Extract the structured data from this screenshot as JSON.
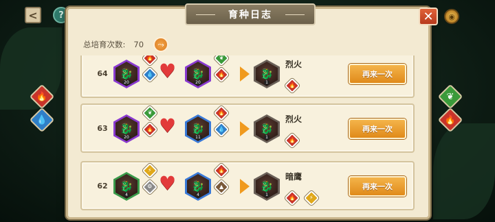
{
  "panel": {
    "title": "育种日志",
    "total_label": "总培育次数:",
    "total_value": "70"
  },
  "nav": {
    "back_glyph": "<",
    "help_glyph": "?",
    "close_glyph": "✕"
  },
  "records": [
    {
      "index": "64",
      "parent_a": {
        "level": "20",
        "frame": "purple",
        "elements": [
          "fire",
          "water"
        ]
      },
      "parent_b": {
        "level": "20",
        "frame": "purple",
        "elements": [
          "nature",
          "fire"
        ]
      },
      "child": {
        "level": "1",
        "name": "烈火",
        "elements": [
          "fire"
        ]
      },
      "button_label": "再来一次"
    },
    {
      "index": "63",
      "parent_a": {
        "level": "20",
        "frame": "purple",
        "elements": [
          "nature",
          "fire"
        ]
      },
      "parent_b": {
        "level": "11",
        "frame": "blue",
        "elements": [
          "fire",
          "water"
        ]
      },
      "child": {
        "level": "1",
        "name": "烈火",
        "elements": [
          "fire"
        ]
      },
      "button_label": "再来一次"
    },
    {
      "index": "62",
      "parent_a": {
        "level": "4",
        "frame": "green",
        "elements": [
          "electric",
          "metal"
        ]
      },
      "parent_b": {
        "level": "4",
        "frame": "blue",
        "elements": [
          "fire",
          "earth"
        ]
      },
      "child": {
        "level": "1",
        "name": "暗鹰",
        "elements": [
          "fire",
          "electric"
        ]
      },
      "button_label": "再来一次"
    }
  ],
  "side_left": [
    "fire",
    "water"
  ],
  "side_right": [
    "nature",
    "fire"
  ],
  "colors": {
    "fire": "#c8342a",
    "water": "#2f7fc8",
    "nature": "#3a9a3a",
    "electric": "#e0a81a",
    "metal": "#8a8a8a",
    "earth": "#7a5a3a",
    "purple": "#8a3ad0",
    "blue": "#3a7ad8",
    "green": "#3a9a4a",
    "child": "#6a6058"
  },
  "element_glyphs": {
    "fire": "🔥",
    "water": "💧",
    "nature": "❦",
    "electric": "⚡",
    "metal": "⚙",
    "earth": "▲"
  }
}
